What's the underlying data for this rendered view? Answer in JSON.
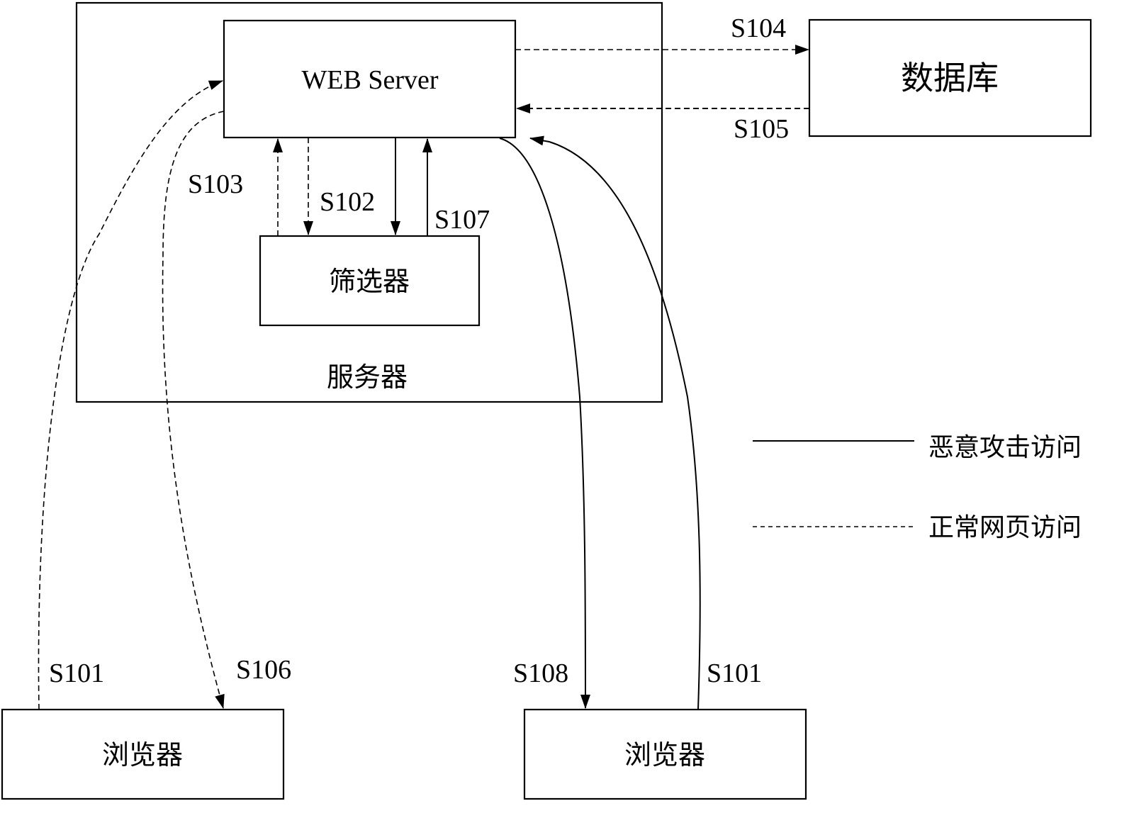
{
  "nodes": {
    "server_container": {
      "label": "服务器"
    },
    "web_server": {
      "label": "WEB Server"
    },
    "filter": {
      "label": "筛选器"
    },
    "database": {
      "label": "数据库"
    },
    "browser_left": {
      "label": "浏览器"
    },
    "browser_right": {
      "label": "浏览器"
    }
  },
  "steps": {
    "s101_left": "S101",
    "s101_right": "S101",
    "s102": "S102",
    "s103": "S103",
    "s104": "S104",
    "s105": "S105",
    "s106": "S106",
    "s107": "S107",
    "s108": "S108"
  },
  "edges": [
    {
      "id": "s101-left",
      "from": "browser_left",
      "to": "web_server",
      "style": "dashed",
      "label": "S101"
    },
    {
      "id": "s102-dashed",
      "from": "web_server",
      "to": "filter",
      "style": "dashed",
      "label": "S102"
    },
    {
      "id": "s102-solid",
      "from": "web_server",
      "to": "filter",
      "style": "solid",
      "label": "S102"
    },
    {
      "id": "s103",
      "from": "filter",
      "to": "web_server",
      "style": "dashed",
      "label": "S103"
    },
    {
      "id": "s104",
      "from": "web_server",
      "to": "database",
      "style": "dashed",
      "label": "S104"
    },
    {
      "id": "s105",
      "from": "database",
      "to": "web_server",
      "style": "dashed",
      "label": "S105"
    },
    {
      "id": "s106",
      "from": "web_server",
      "to": "browser_left",
      "style": "dashed",
      "label": "S106"
    },
    {
      "id": "s107",
      "from": "filter",
      "to": "web_server",
      "style": "solid",
      "label": "S107"
    },
    {
      "id": "s108",
      "from": "web_server",
      "to": "browser_right",
      "style": "solid",
      "label": "S108"
    },
    {
      "id": "s101-right",
      "from": "browser_right",
      "to": "web_server",
      "style": "solid",
      "label": "S101"
    }
  ],
  "legend": {
    "solid_label": "恶意攻击访问",
    "dashed_label": "正常网页访问"
  }
}
